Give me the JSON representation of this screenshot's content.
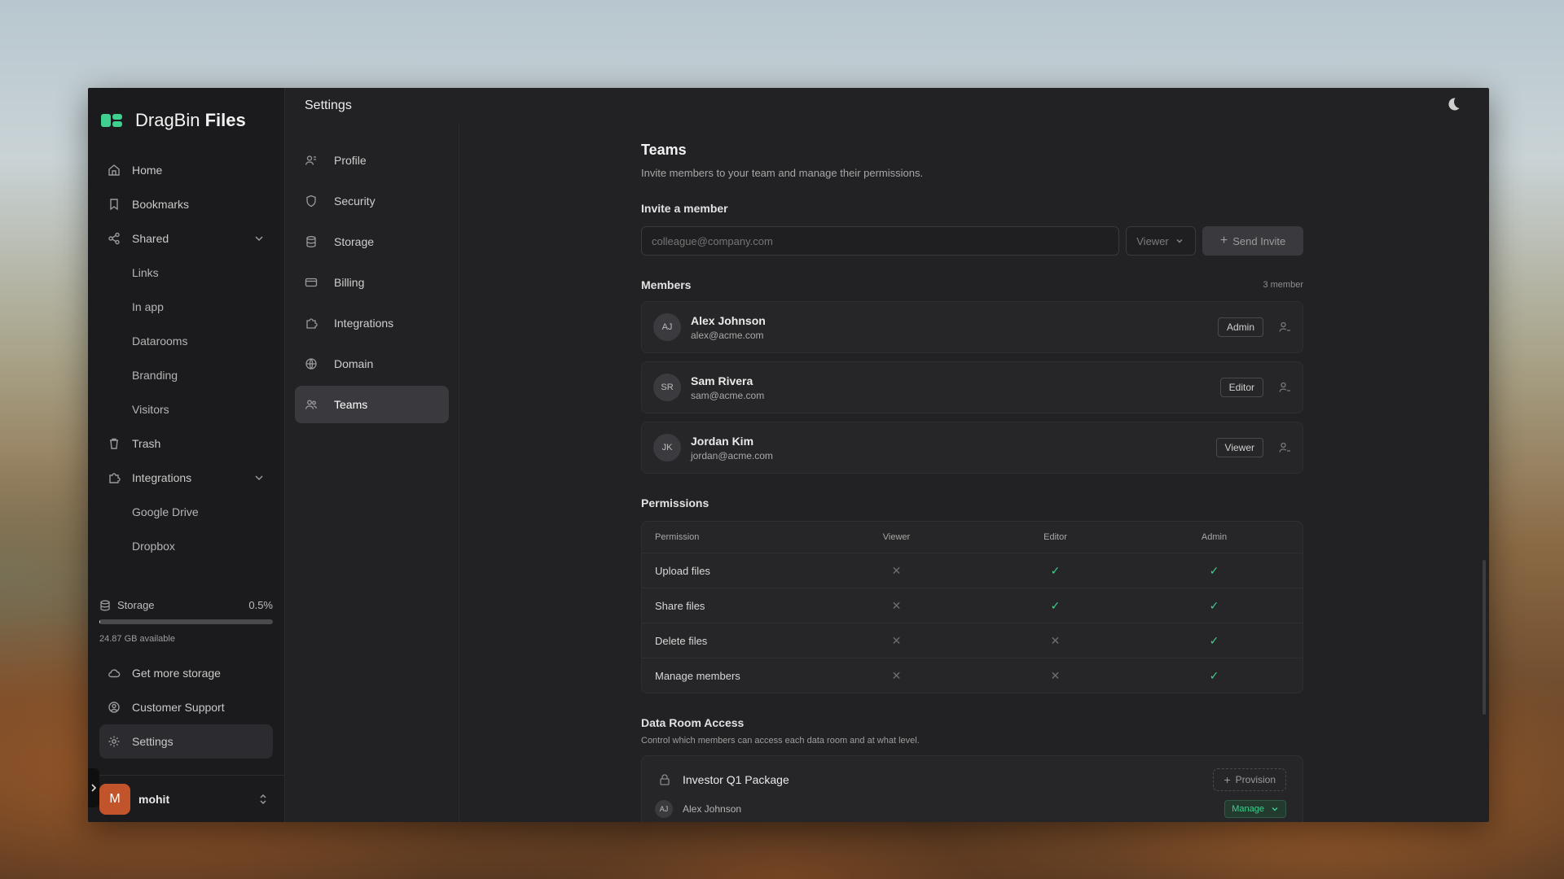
{
  "brand": {
    "name": "DragBin",
    "suffix": "Files"
  },
  "sidebar": {
    "items": [
      {
        "label": "Home",
        "icon": "home-icon"
      },
      {
        "label": "Bookmarks",
        "icon": "bookmark-icon"
      },
      {
        "label": "Shared",
        "icon": "share-icon"
      },
      {
        "label": "Links"
      },
      {
        "label": "In app"
      },
      {
        "label": "Datarooms"
      },
      {
        "label": "Branding"
      },
      {
        "label": "Visitors"
      },
      {
        "label": "Trash",
        "icon": "trash-icon"
      },
      {
        "label": "Integrations",
        "icon": "puzzle-icon"
      },
      {
        "label": "Google Drive"
      },
      {
        "label": "Dropbox"
      }
    ],
    "storage": {
      "label": "Storage",
      "percent_label": "0.5%",
      "used_fraction": 0.005,
      "available": "24.87 GB available"
    },
    "bottom": [
      {
        "label": "Get more storage",
        "icon": "cloud-icon"
      },
      {
        "label": "Customer Support",
        "icon": "support-icon"
      },
      {
        "label": "Settings",
        "icon": "gear-icon"
      }
    ],
    "user": {
      "initial": "M",
      "name": "mohit"
    }
  },
  "topbar": {
    "title": "Settings"
  },
  "settings_nav": [
    {
      "label": "Profile",
      "icon": "user-icon"
    },
    {
      "label": "Security",
      "icon": "shield-icon"
    },
    {
      "label": "Storage",
      "icon": "database-icon"
    },
    {
      "label": "Billing",
      "icon": "card-icon"
    },
    {
      "label": "Integrations",
      "icon": "puzzle-icon"
    },
    {
      "label": "Domain",
      "icon": "globe-icon"
    },
    {
      "label": "Teams",
      "icon": "users-icon"
    }
  ],
  "teams": {
    "title": "Teams",
    "description": "Invite members to your team and manage their permissions.",
    "invite_label": "Invite a member",
    "invite_placeholder": "colleague@company.com",
    "role_selected": "Viewer",
    "send_label": "Send Invite",
    "members_label": "Members",
    "members_count": "3 member",
    "members": [
      {
        "initials": "AJ",
        "name": "Alex Johnson",
        "email": "alex@acme.com",
        "role": "Admin"
      },
      {
        "initials": "SR",
        "name": "Sam Rivera",
        "email": "sam@acme.com",
        "role": "Editor"
      },
      {
        "initials": "JK",
        "name": "Jordan Kim",
        "email": "jordan@acme.com",
        "role": "Viewer"
      }
    ],
    "permissions_label": "Permissions",
    "perm_headers": [
      "Permission",
      "Viewer",
      "Editor",
      "Admin"
    ],
    "permissions": [
      {
        "name": "Upload files",
        "viewer": false,
        "editor": true,
        "admin": true
      },
      {
        "name": "Share files",
        "viewer": false,
        "editor": true,
        "admin": true
      },
      {
        "name": "Delete files",
        "viewer": false,
        "editor": false,
        "admin": true
      },
      {
        "name": "Manage members",
        "viewer": false,
        "editor": false,
        "admin": true
      }
    ],
    "data_room_label": "Data Room Access",
    "data_room_desc": "Control which members can access each data room and at what level.",
    "room": {
      "name": "Investor Q1 Package",
      "provision_label": "Provision",
      "member_initials": "AJ",
      "member_name": "Alex Johnson",
      "manage_label": "Manage"
    }
  }
}
